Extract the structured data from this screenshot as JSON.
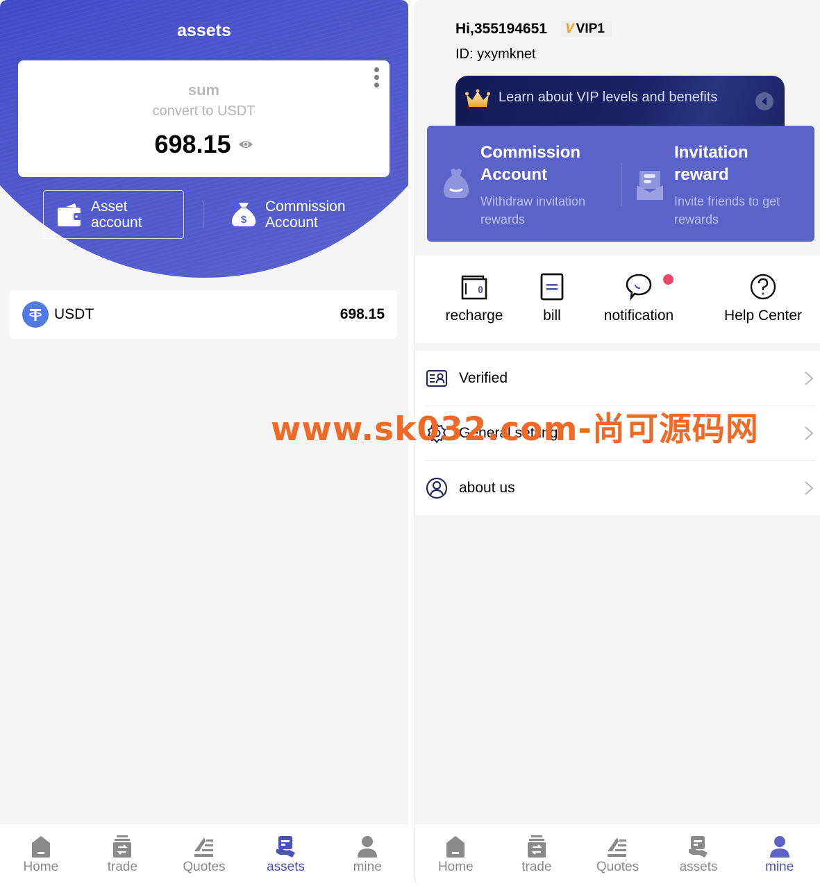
{
  "assets_screen": {
    "title": "assets",
    "summary": {
      "label": "sum",
      "subtitle": "convert to USDT",
      "value": "698.15",
      "more_icon": "more-vertical-icon",
      "visibility_icon": "eye-icon"
    },
    "account_buttons": [
      {
        "label_line1": "Asset",
        "label_line2": "account",
        "icon": "wallet-icon",
        "selected": true
      },
      {
        "label_line1": "Commission",
        "label_line2": "Account",
        "icon": "money-bag-icon",
        "selected": false
      }
    ],
    "coins": [
      {
        "symbol": "USDT",
        "balance": "698.15",
        "icon": "tether-icon"
      }
    ]
  },
  "mine_screen": {
    "greeting": "Hi,355194651",
    "vip_badge": {
      "prefix": "V",
      "label": "VIP1"
    },
    "user_id": "ID: yxymknet",
    "vip_banner": {
      "text": "Learn about VIP levels and benefits",
      "icon": "crown-icon",
      "arrow_icon": "arrow-left-circle-icon"
    },
    "promo_cards": [
      {
        "title_line1": "Commission",
        "title_line2": "Account",
        "sub_line1": "Withdraw invitation",
        "sub_line2": "rewards",
        "icon": "money-bag-icon"
      },
      {
        "title_line1": "Invitation",
        "title_line2": "reward",
        "sub_line1": "Invite friends to get",
        "sub_line2": "rewards",
        "icon": "envelope-icon"
      }
    ],
    "quick_actions": [
      {
        "label": "recharge",
        "icon": "wallet-card-icon"
      },
      {
        "label": "bill",
        "icon": "document-icon"
      },
      {
        "label": "notification",
        "icon": "chat-bubble-icon",
        "has_badge": true
      },
      {
        "label": "Help Center",
        "icon": "help-circle-icon"
      }
    ],
    "menu": [
      {
        "label": "Verified",
        "icon": "id-card-icon"
      },
      {
        "label": "General setting",
        "icon": "gear-icon"
      },
      {
        "label": "about us",
        "icon": "user-circle-icon"
      }
    ]
  },
  "tabbar": {
    "items": [
      {
        "label": "Home",
        "icon": "home-icon"
      },
      {
        "label": "trade",
        "icon": "trade-icon"
      },
      {
        "label": "Quotes",
        "icon": "quotes-icon"
      },
      {
        "label": "assets",
        "icon": "assets-icon"
      },
      {
        "label": "mine",
        "icon": "user-icon"
      }
    ],
    "left_active": "assets",
    "right_active": "mine"
  },
  "colors": {
    "brand": "#4a52b5",
    "hero_blue": "#3f46c9",
    "promo_blue": "#5b63c8",
    "vip_navy": "#151d5c",
    "badge_red": "#ec4965",
    "vip_gold": "#f2a023",
    "watermark": "#ef6a26"
  },
  "watermark": "www.sk032.com-尚可源码网"
}
